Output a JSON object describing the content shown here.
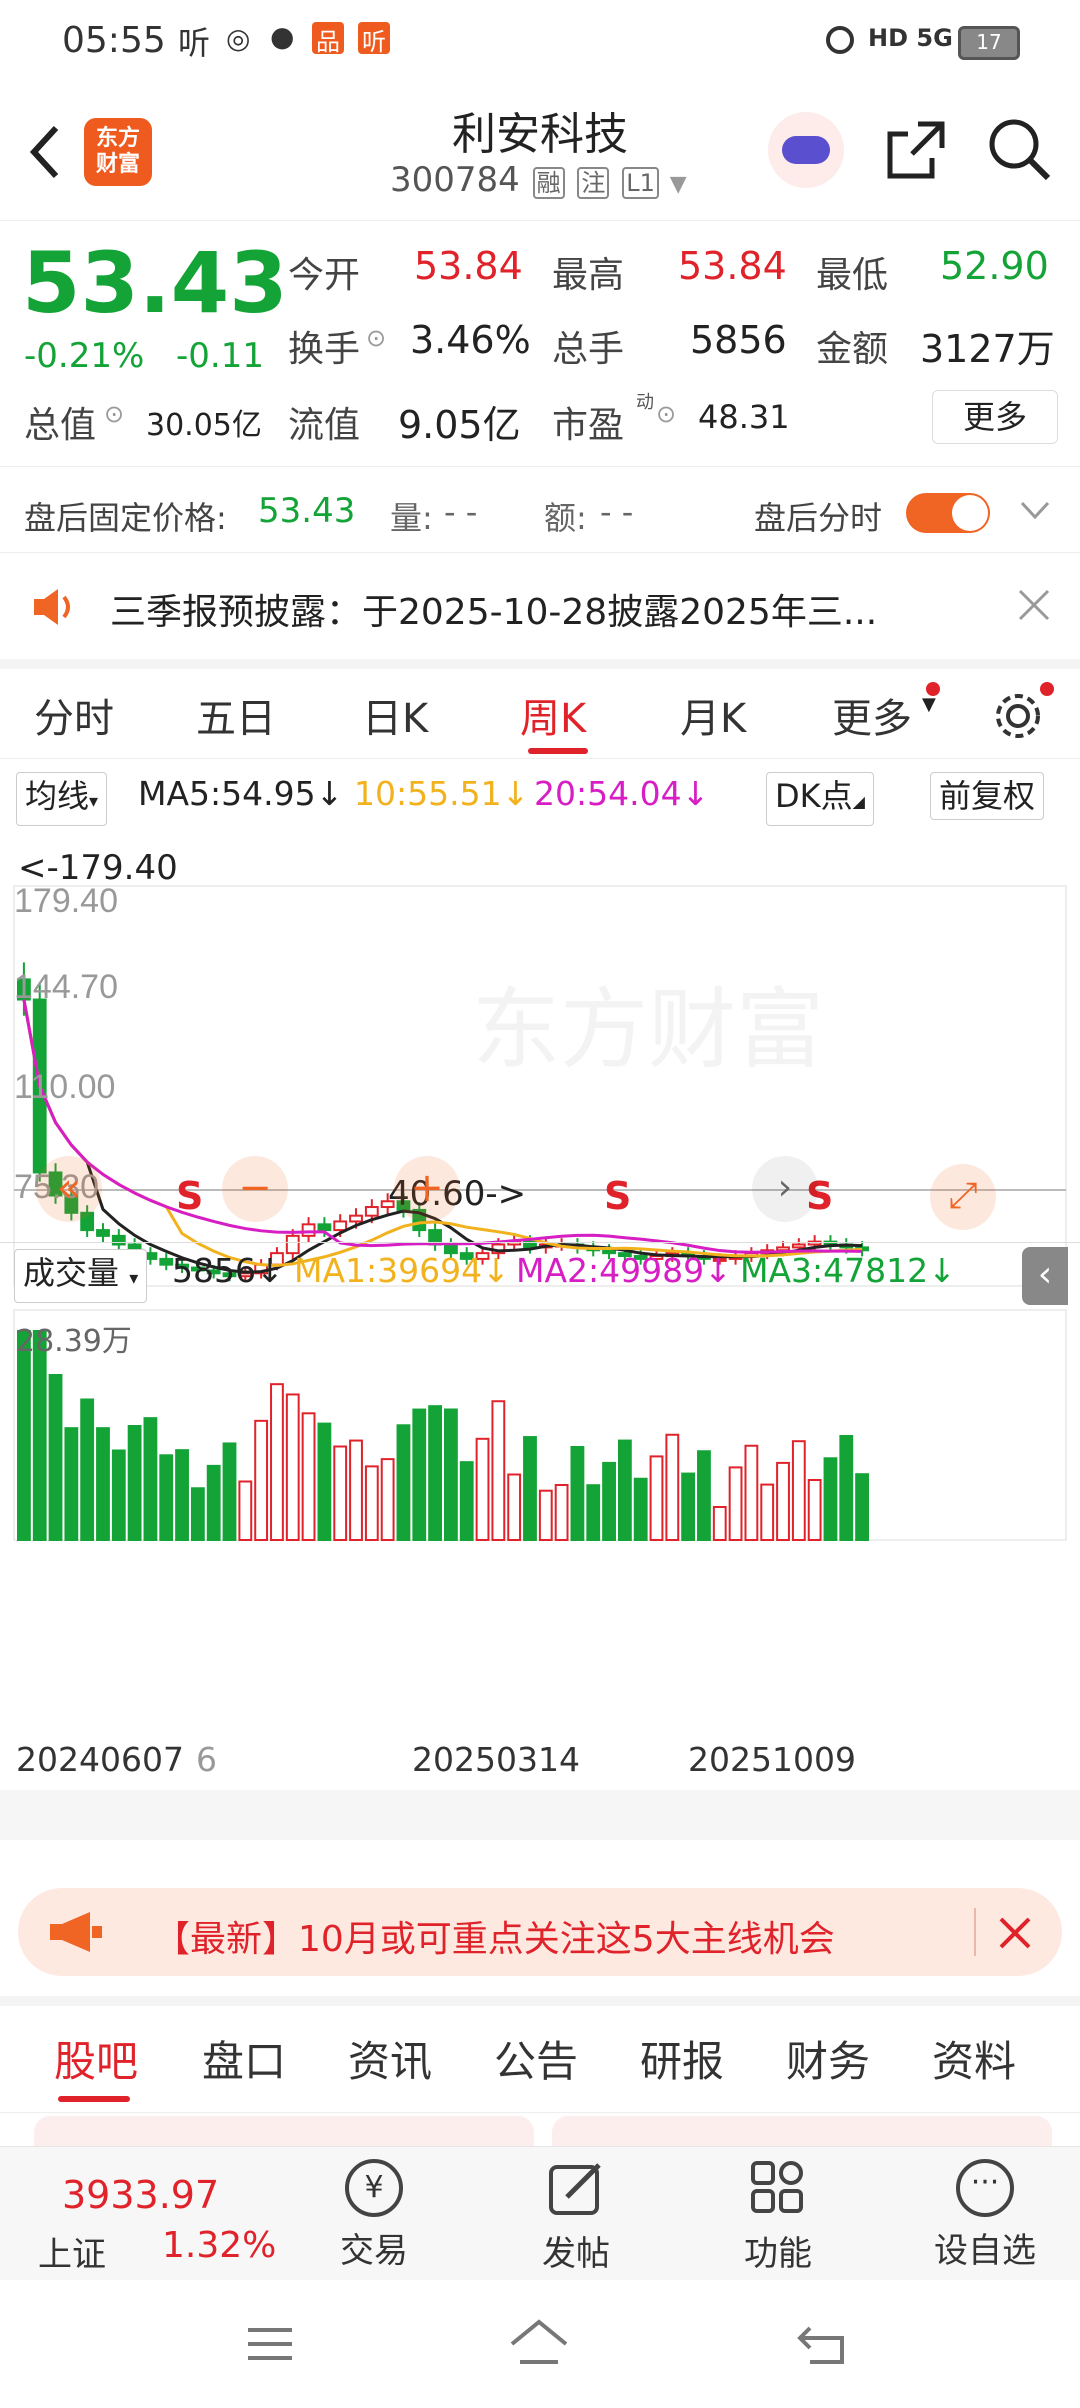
{
  "status_bar": {
    "time": "05:55",
    "app_icons": [
      "听",
      "◎",
      "●",
      "品",
      "听"
    ],
    "right": "HD 5G",
    "battery": "17"
  },
  "header": {
    "logo_text": "东方财富",
    "title": "利安科技",
    "code": "300784",
    "tags": [
      "融",
      "注",
      "L1"
    ]
  },
  "quote": {
    "price": "53.43",
    "change_pct": "-0.21%",
    "change": "-0.11",
    "open_label": "今开",
    "open": "53.84",
    "high_label": "最高",
    "high": "53.84",
    "low_label": "最低",
    "low": "52.90",
    "turnover_label": "换手",
    "turnover": "3.46%",
    "volume_label": "总手",
    "volume": "5856",
    "amount_label": "金额",
    "amount": "3127万",
    "mktcap_label": "总值",
    "mktcap": "30.05亿",
    "float_label": "流值",
    "float": "9.05亿",
    "pe_label": "市盈",
    "pe_sup": "动",
    "pe": "48.31",
    "more_label": "更多"
  },
  "afterhours": {
    "price_label": "盘后固定价格:",
    "price": "53.43",
    "vol_label": "量:",
    "vol": "- -",
    "amt_label": "额:",
    "amt": "- -",
    "timeshare_label": "盘后分时"
  },
  "notice": {
    "text": "三季报预披露：于2025-10-28披露2025年三..."
  },
  "chart_tabs": [
    "分时",
    "五日",
    "日K",
    "周K",
    "月K",
    "更多"
  ],
  "chart_tab_active": 3,
  "kline": {
    "ma_button": "均线",
    "ma5": "MA5:54.95↓",
    "ma10": "10:55.51↓",
    "ma20": "20:54.04↓",
    "dk_button": "DK点",
    "adjust_button": "前复权",
    "watermark": "东方财富",
    "y_labels": [
      "179.40",
      "144.70",
      "110.00",
      "75.30",
      "40.60"
    ],
    "max_marker": "<-179.40",
    "min_marker": "40.60->",
    "signal": "S"
  },
  "volume": {
    "button": "成交量",
    "value": "5856↓",
    "ma1": "MA1:39694↓",
    "ma2": "MA2:49989↓",
    "ma3": "MA3:47812↓",
    "max_label": "28.39万",
    "dates": [
      "20240607",
      "6",
      "20250314",
      "20251009"
    ]
  },
  "chart_data": {
    "type": "candlestick",
    "title": "",
    "ylim": [
      40.6,
      179.4
    ],
    "weekly_close_approx": [
      140,
      80,
      72,
      66,
      60,
      58,
      55,
      52,
      50,
      48,
      47,
      46,
      45,
      44,
      45,
      48,
      52,
      58,
      62,
      60,
      63,
      65,
      68,
      70,
      67,
      60,
      55,
      52,
      50,
      52,
      55,
      56,
      54,
      55,
      55,
      54,
      53,
      52,
      51,
      50,
      51,
      52,
      51,
      50,
      50,
      51,
      52,
      53,
      54,
      55,
      56,
      55,
      54,
      53
    ],
    "volume_max": "28.39万"
  },
  "banner": {
    "text": "【最新】10月或可重点关注这5大主线机会"
  },
  "bottom_tabs": [
    "股吧",
    "盘口",
    "资讯",
    "公告",
    "研报",
    "财务",
    "资料"
  ],
  "bottom_tab_active": 0,
  "bottom_nav": {
    "index_value": "3933.97",
    "index_name": "上证",
    "index_change": "1.32%",
    "items": [
      "交易",
      "发帖",
      "功能",
      "设自选"
    ]
  },
  "colors": {
    "accent": "#e0232a",
    "green": "#13a336",
    "orange": "#f06424",
    "ma5": "#222222",
    "ma10": "#f2b21e",
    "ma20": "#d61ec4"
  }
}
